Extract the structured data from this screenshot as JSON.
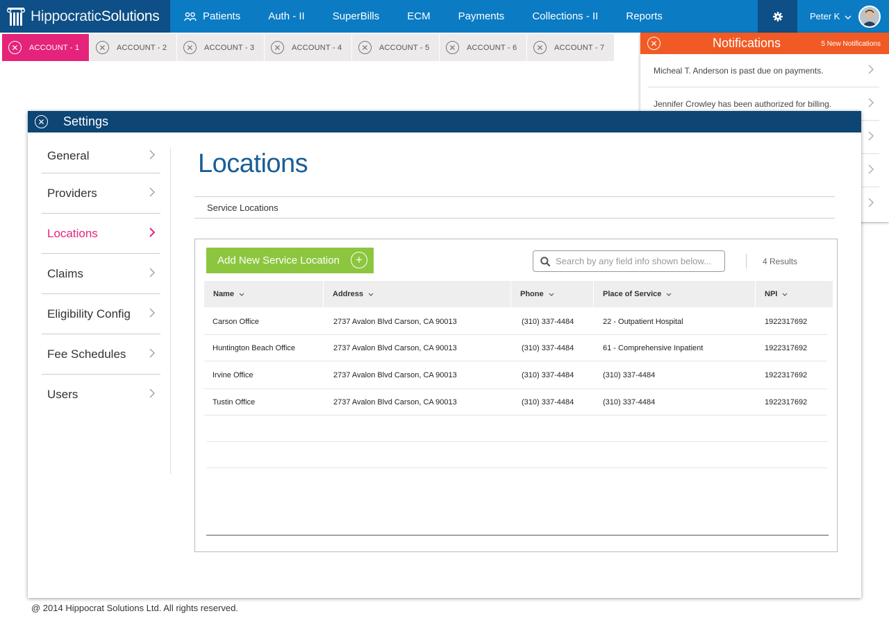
{
  "app": {
    "brand_light": "Hippocratic",
    "brand_bold": "Solutions"
  },
  "nav": {
    "items": [
      "Patients",
      "Auth - II",
      "SuperBills",
      "ECM",
      "Payments",
      "Collections - II",
      "Reports"
    ],
    "user_name": "Peter K"
  },
  "account_tabs": [
    "ACCOUNT - 1",
    "ACCOUNT - 2",
    "ACCOUNT - 3",
    "ACCOUNT - 4",
    "ACCOUNT - 5",
    "ACCOUNT - 6",
    "ACCOUNT - 7"
  ],
  "notifications": {
    "title": "Notifications",
    "count_label": "5 New Notifications",
    "items": [
      "Micheal T. Anderson is past due on payments.",
      "Jennifer Crowley has been authorized for billing.",
      "",
      "",
      ""
    ]
  },
  "settings": {
    "title": "Settings",
    "side_items": [
      "General",
      "Providers",
      "Locations",
      "Claims",
      "Eligibility Config",
      "Fee Schedules",
      "Users"
    ],
    "active_item": "Locations",
    "page_title": "Locations",
    "subtab": "Service Locations",
    "add_button": "Add New Service Location",
    "search_placeholder": "Search by any field info shown below...",
    "results": "4 Results",
    "columns": [
      "Name",
      "Address",
      "Phone",
      "Place of Service",
      "NPI"
    ],
    "rows": [
      [
        "Carson Office",
        "2737 Avalon Blvd Carson, CA 90013",
        "(310) 337-4484",
        "22 - Outpatient Hospital",
        "1922317692"
      ],
      [
        "Huntington Beach Office",
        "2737 Avalon Blvd Carson, CA 90013",
        "(310) 337-4484",
        "61 - Comprehensive Inpatient",
        "1922317692"
      ],
      [
        "Irvine Office",
        "2737 Avalon Blvd Carson, CA 90013",
        "(310) 337-4484",
        "(310) 337-4484",
        "1922317692"
      ],
      [
        "Tustin Office",
        "2737 Avalon Blvd Carson, CA 90013",
        "(310) 337-4484",
        "(310) 337-4484",
        "1922317692"
      ]
    ]
  },
  "footer": "@ 2014 Hippocrat Solutions Ltd. All rights reserved.",
  "colors": {
    "nav_blue": "#0b7bc3",
    "dark_blue": "#0d4f86",
    "accent_pink": "#e5237a",
    "notif_orange": "#f15a24",
    "add_green": "#8cc63f"
  }
}
